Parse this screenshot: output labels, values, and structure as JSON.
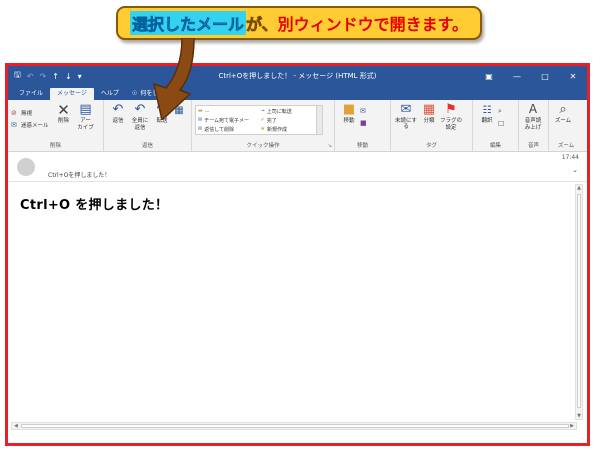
{
  "callout": {
    "highlight": "選択したメール",
    "middle": "が、",
    "red": "別ウィンドウで開きます。"
  },
  "titlebar": {
    "title": "Ctrl+Oを押しました！ - メッセージ (HTML 形式)"
  },
  "tabs": [
    {
      "label": "ファイル"
    },
    {
      "label": "メッセージ"
    },
    {
      "label": "ヘルプ"
    }
  ],
  "tell_me": "何をしますか",
  "ribbon": {
    "delete_group": {
      "ignore": "無視",
      "junk": "迷惑メール",
      "delete": "削除",
      "archive_1": "アー",
      "archive_2": "カイブ",
      "label": "削除"
    },
    "respond_group": {
      "reply": "返信",
      "reply_all_1": "全員に",
      "reply_all_2": "返信",
      "forward": "転送",
      "label": "返信"
    },
    "quick_steps": {
      "q1": "...",
      "q2": "上司に転送",
      "q3": "チーム宛て電子メー",
      "q4": "完了",
      "q5": "返信して削除",
      "q6": "新規作成",
      "label": "クイック操作"
    },
    "move_group": {
      "move": "移動",
      "label": "移動"
    },
    "tags_group": {
      "unread": "未読にする",
      "categorize": "分類",
      "followup_1": "フラグの",
      "followup_2": "設定",
      "label": "タグ"
    },
    "edit_group": {
      "translate": "翻訳",
      "label": "編集"
    },
    "speech_group": {
      "read_1": "音声読",
      "read_2": "み上げ",
      "label": "音声"
    },
    "zoom_group": {
      "zoom": "ズーム",
      "label": "ズーム"
    }
  },
  "message": {
    "subject": "Ctrl+Oを押しました！",
    "time": "17:44",
    "body": "Ctrl+O を押しました！"
  }
}
